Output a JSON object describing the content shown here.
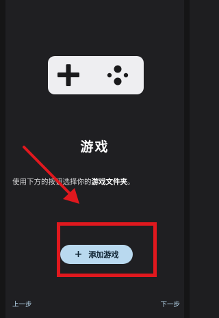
{
  "app": {
    "title": "游戏",
    "description_prefix": "使用下方的按钮选择你的",
    "description_bold": "游戏文件夹",
    "description_suffix": "。"
  },
  "actions": {
    "add_game_label": "添加游戏",
    "add_game_icon": "plus-icon"
  },
  "navigation": {
    "prev_label": "上一步",
    "next_label": "下一步"
  },
  "illustration": {
    "icon": "gamepad-icon"
  },
  "annotations": {
    "highlight_color": "#e0181e",
    "arrow_color": "#e0181e"
  },
  "colors": {
    "background": "#1f1f22",
    "accent": "#b9d9ef",
    "gamepad": "#eeeef1"
  }
}
